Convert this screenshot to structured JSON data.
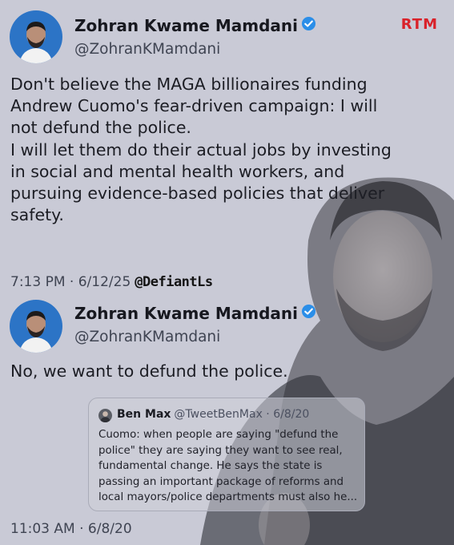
{
  "brand_logo": "RTM",
  "watermark": "@DefiantLs",
  "colors": {
    "verified": "#2b8ee8",
    "brand": "#d9222a",
    "background": "#c9cad6"
  },
  "tweet1": {
    "author_name": "Zohran Kwame Mamdani",
    "handle": "@ZohranKMamdani",
    "lines": [
      "Don't believe the MAGA billionaires funding",
      "Andrew Cuomo's fear-driven campaign: I will",
      "not defund the police.",
      "I will let them do their actual jobs by investing",
      "in social and mental health workers, and",
      "pursuing evidence-based policies that deliver",
      "safety."
    ],
    "time": "7:13 PM",
    "separator": "·",
    "date": "6/12/25"
  },
  "tweet2": {
    "author_name": "Zohran Kwame Mamdani",
    "handle": "@ZohranKMamdani",
    "text": "No, we want to defund the police.",
    "time": "11:03 AM",
    "separator": "·",
    "date": "6/8/20",
    "quoted": {
      "author_name": "Ben Max",
      "handle_date": "@TweetBenMax · 6/8/20",
      "lines": [
        "Cuomo: when people are saying \"defund the",
        "police\" they are saying they want to see real,",
        "fundamental change. He says the state is",
        "passing an important package of reforms and",
        "local mayors/police departments must also he..."
      ]
    }
  }
}
